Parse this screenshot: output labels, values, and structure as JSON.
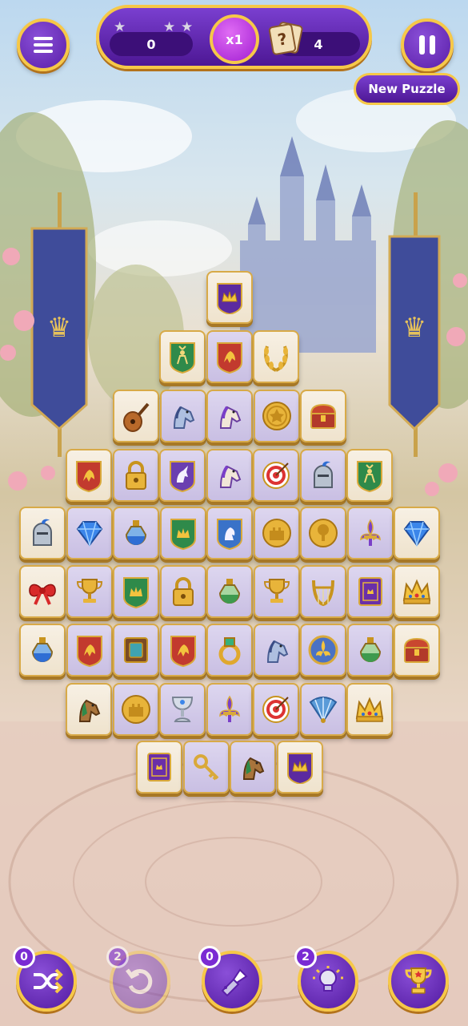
{
  "hud": {
    "score": "0",
    "multiplier": "x1",
    "hints_value": "4",
    "new_puzzle_label": "New Puzzle"
  },
  "boosters": [
    {
      "name": "shuffle",
      "count": "0",
      "icon": "shuffle-icon",
      "enabled": true
    },
    {
      "name": "undo",
      "count": "2",
      "icon": "undo-icon",
      "enabled": false
    },
    {
      "name": "flashlight",
      "count": "0",
      "icon": "flashlight-icon",
      "enabled": true
    },
    {
      "name": "hint",
      "count": "2",
      "icon": "lightbulb-icon",
      "enabled": true
    },
    {
      "name": "trophy",
      "count": "",
      "icon": "trophy-icon",
      "enabled": true
    }
  ],
  "board": {
    "rows": [
      [
        "crown-purple"
      ],
      [
        "shield-stag",
        "shield-griffin",
        "laurel"
      ],
      [
        "lute",
        "horse-blue",
        "horse-purple",
        "coin-emblem",
        "treasure-chest"
      ],
      [
        "shield-griffin",
        "padlock",
        "shield-unicorn",
        "horse-purple",
        "target",
        "knight-helmet",
        "shield-stag"
      ],
      [
        "knight-helmet",
        "diamond",
        "potion-blue",
        "shield-crown-green",
        "shield-lion",
        "coin-castle",
        "coin-tree",
        "fleur-de-lis",
        "diamond"
      ],
      [
        "bow",
        "trophy-cup",
        "shield-crown-green",
        "padlock",
        "potion-green",
        "trophy-cup",
        "lyre",
        "book-purple",
        "crown-gold"
      ],
      [
        "potion-blue",
        "shield-griffin",
        "book-brown",
        "shield-griffin",
        "ring",
        "horse-blue",
        "medallion-fleur",
        "potion-green",
        "treasure-chest"
      ],
      [
        "horse-green",
        "coin-castle",
        "chalice",
        "fleur-de-lis",
        "target",
        "fan",
        "crown-gold"
      ],
      [
        "book-purple",
        "key",
        "horse-green",
        "crown-purple"
      ]
    ]
  },
  "colors": {
    "hud_purple": "#5a1fa8",
    "gold_border": "#f6c848",
    "tile_face": "#f7f0e4",
    "tile_dim": "#ccc2e6"
  }
}
